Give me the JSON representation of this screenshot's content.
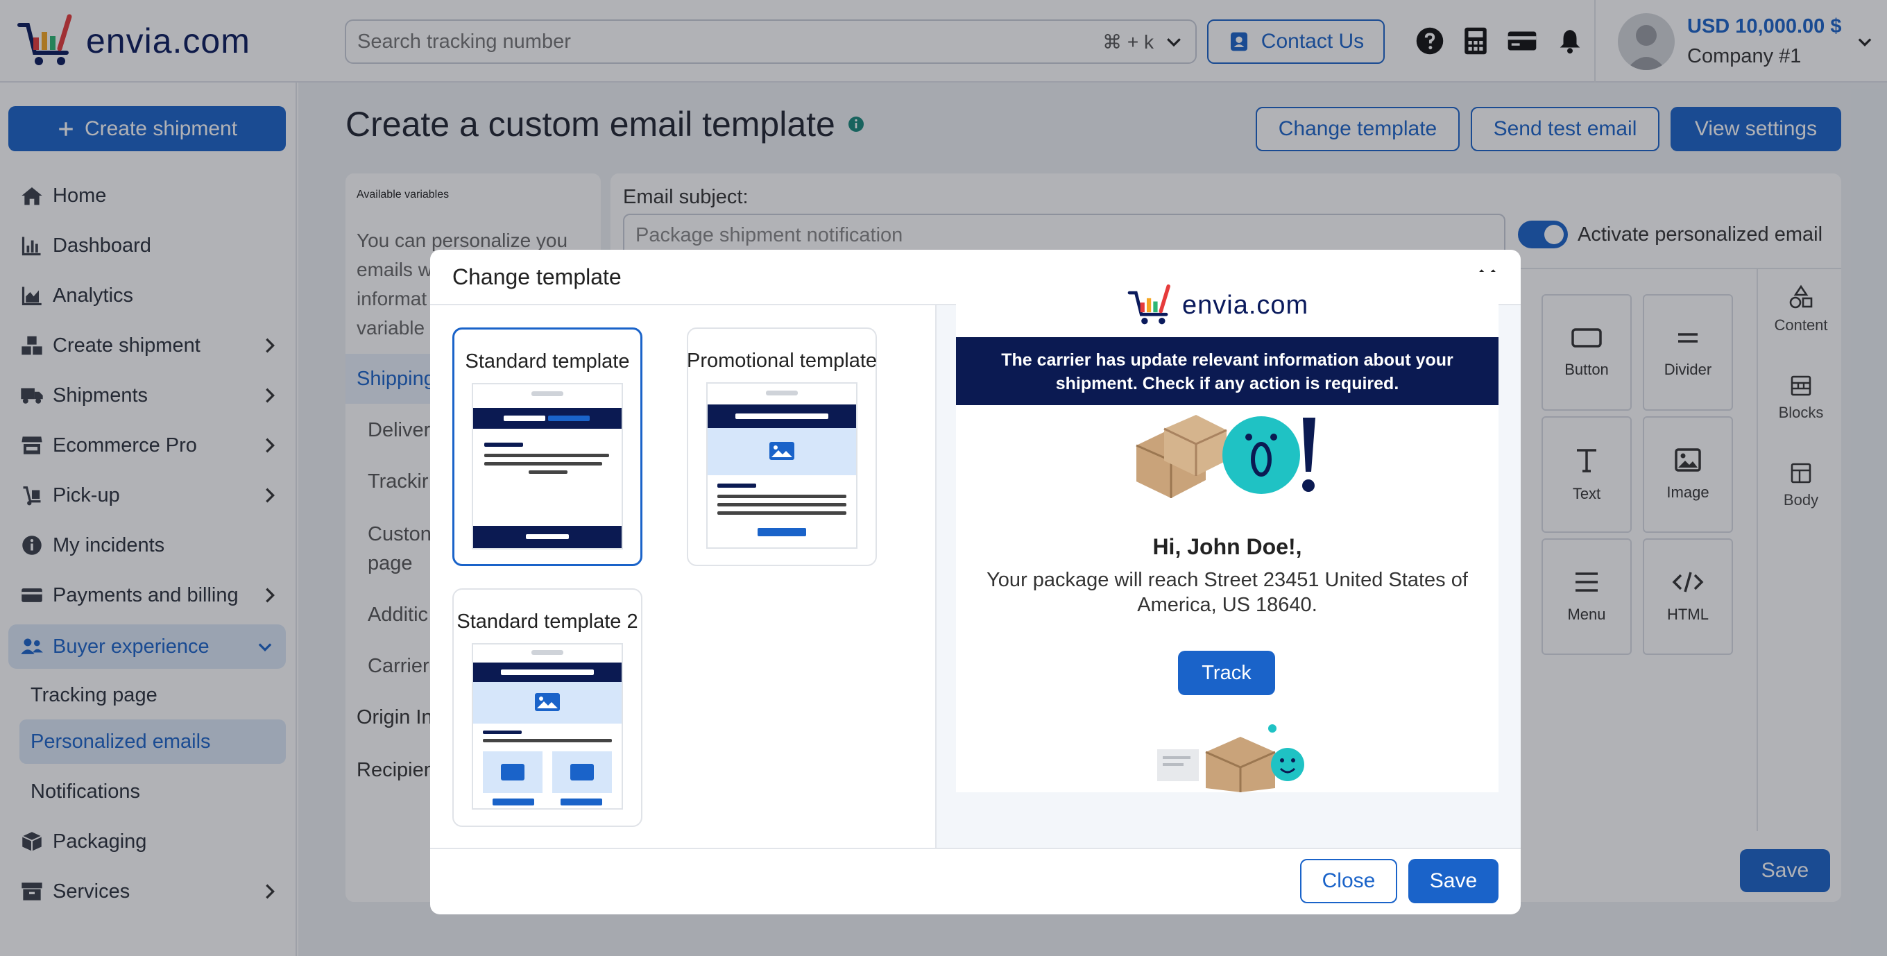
{
  "brand": {
    "name": "envia.com"
  },
  "topbar": {
    "search_placeholder": "Search tracking number",
    "shortcut": "⌘ + k",
    "contact_label": "Contact Us",
    "balance": "USD 10,000.00 $",
    "company": "Company #1"
  },
  "sidebar": {
    "create_button": "Create shipment",
    "items": [
      {
        "label": "Home",
        "icon": "home-icon"
      },
      {
        "label": "Dashboard",
        "icon": "bar-chart-icon"
      },
      {
        "label": "Analytics",
        "icon": "area-chart-icon"
      },
      {
        "label": "Create shipment",
        "icon": "boxes-icon"
      },
      {
        "label": "Shipments",
        "icon": "truck-icon"
      },
      {
        "label": "Ecommerce Pro",
        "icon": "store-icon"
      },
      {
        "label": "Pick-up",
        "icon": "dolly-icon"
      },
      {
        "label": "My incidents",
        "icon": "info-icon"
      },
      {
        "label": "Payments and billing",
        "icon": "credit-card-icon"
      },
      {
        "label": "Buyer experience",
        "icon": "users-icon"
      },
      {
        "label": "Packaging",
        "icon": "package-icon"
      },
      {
        "label": "Services",
        "icon": "archive-icon"
      }
    ],
    "subitems": [
      "Tracking page",
      "Personalized emails",
      "Notifications"
    ]
  },
  "page": {
    "title": "Create a custom email template",
    "buttons": {
      "change": "Change template",
      "test": "Send test email",
      "settings": "View settings"
    }
  },
  "variables": {
    "title": "Available variables",
    "desc": [
      "You can personalize you",
      "emails w",
      "informat",
      "variable"
    ],
    "section": "Shipping",
    "items": [
      "Deliver",
      "Trackir",
      "Custon",
      "page",
      "Additic",
      "Carrier"
    ],
    "groups": [
      "Origin In",
      "Recipien"
    ]
  },
  "editor": {
    "subject_label": "Email subject:",
    "subject_value": "Package shipment notification",
    "activate_label": "Activate personalized email",
    "tools": [
      "Button",
      "Divider",
      "Text",
      "Image",
      "Menu",
      "HTML"
    ],
    "tabs": [
      "Content",
      "Blocks",
      "Body"
    ],
    "save": "Save"
  },
  "modal": {
    "title": "Change template",
    "templates": [
      "Standard template",
      "Promotional template",
      "Standard template 2"
    ],
    "preview": {
      "banner": "The carrier has update relevant information about your shipment. Check if any action is required.",
      "greeting": "Hi, John Doe!,",
      "body": "Your package will reach Street 23451 United States of America, US 18640.",
      "track": "Track"
    },
    "close": "Close",
    "save": "Save"
  },
  "colors": {
    "accent": "#1a63c9",
    "navy": "#0b1a52",
    "active_bg": "#dce8f8"
  }
}
